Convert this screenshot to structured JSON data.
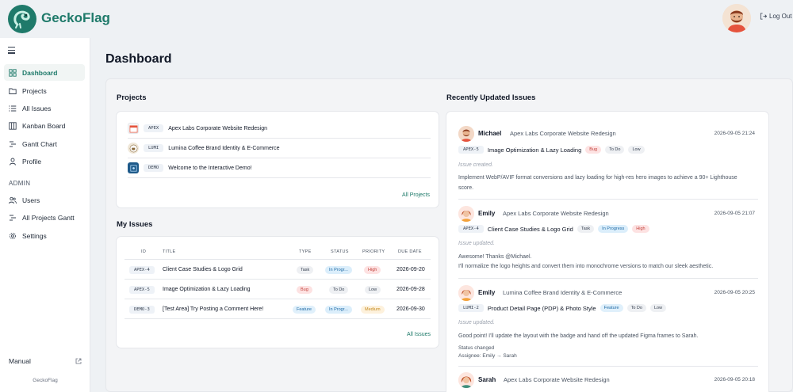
{
  "header": {
    "brand": "GeckoFlag",
    "logout_label": "Log Out"
  },
  "sidebar": {
    "items": [
      {
        "label": "Dashboard",
        "icon": "dashboard-icon"
      },
      {
        "label": "Projects",
        "icon": "folder-icon"
      },
      {
        "label": "All Issues",
        "icon": "list-icon"
      },
      {
        "label": "Kanban Board",
        "icon": "kanban-icon"
      },
      {
        "label": "Gantt Chart",
        "icon": "gantt-icon"
      },
      {
        "label": "Profile",
        "icon": "user-icon"
      }
    ],
    "admin_label": "ADMIN",
    "admin_items": [
      {
        "label": "Users",
        "icon": "users-icon"
      },
      {
        "label": "All Projects Gantt",
        "icon": "gantt-icon"
      },
      {
        "label": "Settings",
        "icon": "gear-icon"
      }
    ],
    "manual_label": "Manual",
    "footer": "GeckoFlag"
  },
  "page": {
    "title": "Dashboard"
  },
  "projects": {
    "title": "Projects",
    "items": [
      {
        "code": "APEX",
        "name": "Apex Labs Corporate Website Redesign"
      },
      {
        "code": "LUMI",
        "name": "Lumina Coffee Brand Identity & E-Commerce"
      },
      {
        "code": "DEMO",
        "name": "Welcome to the Interactive Demo!"
      }
    ],
    "link": "All Projects"
  },
  "my_issues": {
    "title": "My Issues",
    "columns": {
      "id": "ID",
      "title": "TITLE",
      "type": "TYPE",
      "status": "STATUS",
      "priority": "PRIORITY",
      "due": "DUE DATE"
    },
    "rows": [
      {
        "id": "APEX-4",
        "title": "Client Case Studies & Logo Grid",
        "type": "Task",
        "status": "In Progr...",
        "priority": "High",
        "due": "2026-09-20"
      },
      {
        "id": "APEX-5",
        "title": "Image Optimization & Lazy Loading",
        "type": "Bug",
        "status": "To Do",
        "priority": "Low",
        "due": "2026-09-28"
      },
      {
        "id": "DEMO-3",
        "title": "[Test Area] Try Posting a Comment Here!",
        "type": "Feature",
        "status": "In Progr...",
        "priority": "Medium",
        "due": "2026-09-30"
      }
    ],
    "link": "All Issues"
  },
  "recent": {
    "title": "Recently Updated Issues",
    "items": [
      {
        "user": "Michael",
        "project": "Apex Labs Corporate Website Redesign",
        "time": "2026-09-05 21:24",
        "code": "APEX-5",
        "issue": "Image Optimization & Lazy Loading",
        "tags": [
          "Bug",
          "To Do",
          "Low"
        ],
        "note": "Issue created.",
        "body": "Implement WebP/AVIF format conversions and lazy loading for high-res hero images to achieve a 90+ Lighthouse score."
      },
      {
        "user": "Emily",
        "project": "Apex Labs Corporate Website Redesign",
        "time": "2026-09-05 21:07",
        "code": "APEX-4",
        "issue": "Client Case Studies & Logo Grid",
        "tags": [
          "Task",
          "In Progress",
          "High"
        ],
        "note": "Issue updated.",
        "body_line1": "Awesome! Thanks @Michael.",
        "body_line2": "I'll normalize the logo heights and convert them into monochrome versions to match our sleek aesthetic."
      },
      {
        "user": "Emily",
        "project": "Lumina Coffee Brand Identity & E-Commerce",
        "time": "2026-09-05 20:25",
        "code": "LUMI-2",
        "issue": "Product Detail Page (PDP) & Photo Style",
        "tags": [
          "Feature",
          "To Do",
          "Low"
        ],
        "note": "Issue updated.",
        "body": "Good point! I'll update the layout with the badge and hand off the updated Figma frames to Sarah.",
        "meta1": "Status changed",
        "meta2": "Assignee: Emily → Sarah"
      },
      {
        "user": "Sarah",
        "project": "Apex Labs Corporate Website Redesign",
        "time": "2026-09-05 20:18"
      }
    ]
  },
  "colors": {
    "accent": "#1f7a6a",
    "bug": "#fde2e2",
    "task": "#eef0f3",
    "feature": "#e0f0fb",
    "todo": "#eef0f3",
    "inprogress": "#dbeefb",
    "low": "#eef0f3",
    "high": "#fde2e2",
    "medium": "#fdf1dc"
  }
}
